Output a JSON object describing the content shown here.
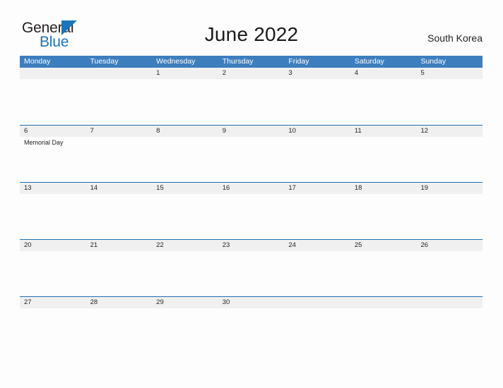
{
  "brand": {
    "name_part1": "General",
    "name_part2": "Blue",
    "flag_icon": "blue-triangle-flag"
  },
  "header": {
    "title": "June 2022",
    "country": "South Korea"
  },
  "colors": {
    "header_blue": "#3d7ebf",
    "rule_blue": "#1f6eb0",
    "band_gray": "#f0f0f0",
    "brand_blue": "#1b75bb",
    "text_dark": "#231f20",
    "page_bg": "#fdfdfd"
  },
  "calendar": {
    "weekdays": [
      "Monday",
      "Tuesday",
      "Wednesday",
      "Thursday",
      "Friday",
      "Saturday",
      "Sunday"
    ],
    "weeks": [
      {
        "days": [
          {
            "number": "",
            "events": []
          },
          {
            "number": "",
            "events": []
          },
          {
            "number": "1",
            "events": []
          },
          {
            "number": "2",
            "events": []
          },
          {
            "number": "3",
            "events": []
          },
          {
            "number": "4",
            "events": []
          },
          {
            "number": "5",
            "events": []
          }
        ]
      },
      {
        "days": [
          {
            "number": "6",
            "events": [
              "Memorial Day"
            ]
          },
          {
            "number": "7",
            "events": []
          },
          {
            "number": "8",
            "events": []
          },
          {
            "number": "9",
            "events": []
          },
          {
            "number": "10",
            "events": []
          },
          {
            "number": "11",
            "events": []
          },
          {
            "number": "12",
            "events": []
          }
        ]
      },
      {
        "days": [
          {
            "number": "13",
            "events": []
          },
          {
            "number": "14",
            "events": []
          },
          {
            "number": "15",
            "events": []
          },
          {
            "number": "16",
            "events": []
          },
          {
            "number": "17",
            "events": []
          },
          {
            "number": "18",
            "events": []
          },
          {
            "number": "19",
            "events": []
          }
        ]
      },
      {
        "days": [
          {
            "number": "20",
            "events": []
          },
          {
            "number": "21",
            "events": []
          },
          {
            "number": "22",
            "events": []
          },
          {
            "number": "23",
            "events": []
          },
          {
            "number": "24",
            "events": []
          },
          {
            "number": "25",
            "events": []
          },
          {
            "number": "26",
            "events": []
          }
        ]
      },
      {
        "days": [
          {
            "number": "27",
            "events": []
          },
          {
            "number": "28",
            "events": []
          },
          {
            "number": "29",
            "events": []
          },
          {
            "number": "30",
            "events": []
          },
          {
            "number": "",
            "events": []
          },
          {
            "number": "",
            "events": []
          },
          {
            "number": "",
            "events": []
          }
        ]
      }
    ]
  }
}
